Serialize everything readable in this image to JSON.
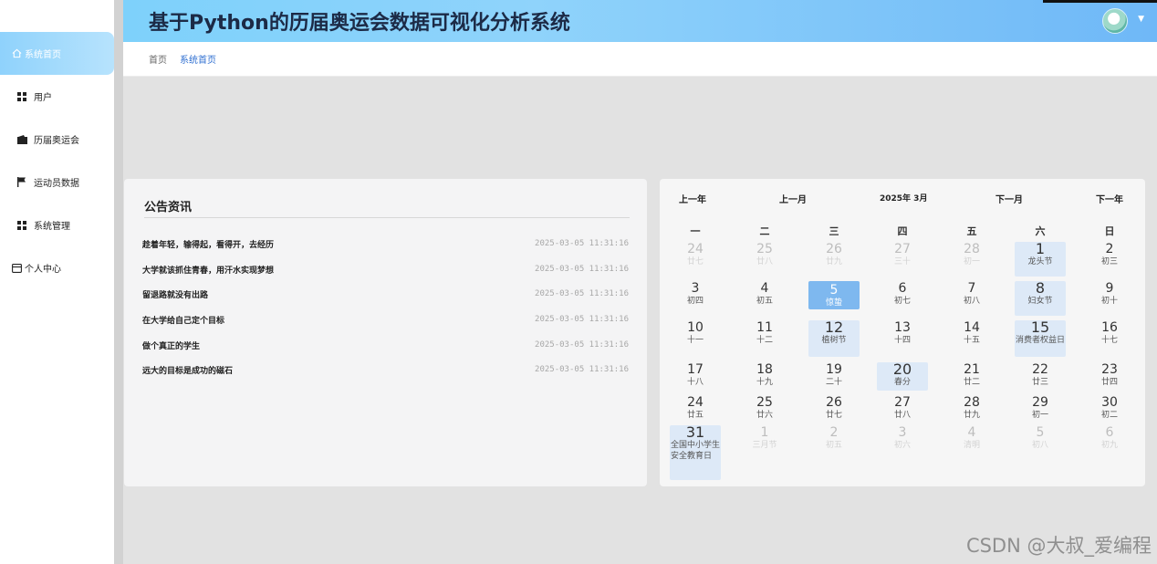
{
  "header": {
    "title": "基于Python的历届奥运会数据可视化分析系统"
  },
  "sidebar": {
    "items": [
      {
        "label": "系统首页",
        "icon": "home-icon"
      },
      {
        "label": "用户",
        "icon": "grid-icon"
      },
      {
        "label": "历届奥运会",
        "icon": "wallet-icon"
      },
      {
        "label": "运动员数据",
        "icon": "flag-icon"
      },
      {
        "label": "系统管理",
        "icon": "grid-icon"
      },
      {
        "label": "个人中心",
        "icon": "card-icon"
      }
    ]
  },
  "breadcrumb": {
    "home": "首页",
    "current": "系统首页"
  },
  "notices": {
    "title": "公告资讯",
    "items": [
      {
        "title": "趁着年轻，输得起，看得开，去经历",
        "date": "2025-03-05 11:31:16"
      },
      {
        "title": "大学就该抓住青春，用汗水实现梦想",
        "date": "2025-03-05 11:31:16"
      },
      {
        "title": "留退路就没有出路",
        "date": "2025-03-05 11:31:16"
      },
      {
        "title": "在大学给自己定个目标",
        "date": "2025-03-05 11:31:16"
      },
      {
        "title": "做个真正的学生",
        "date": "2025-03-05 11:31:16"
      },
      {
        "title": "远大的目标是成功的磁石",
        "date": "2025-03-05 11:31:16"
      }
    ]
  },
  "calendar": {
    "prev_year": "上一年",
    "prev_month": "上一月",
    "month_label": "2025年 3月",
    "next_month": "下一月",
    "next_year": "下一年",
    "weekdays": [
      "一",
      "二",
      "三",
      "四",
      "五",
      "六",
      "日"
    ],
    "days": [
      {
        "n": "24",
        "l": "廿七",
        "dim": true
      },
      {
        "n": "25",
        "l": "廿八",
        "dim": true
      },
      {
        "n": "26",
        "l": "廿九",
        "dim": true
      },
      {
        "n": "27",
        "l": "三十",
        "dim": true
      },
      {
        "n": "28",
        "l": "初一",
        "dim": true
      },
      {
        "n": "1",
        "l": "龙头节",
        "hl": true
      },
      {
        "n": "2",
        "l": "初三"
      },
      {
        "n": "3",
        "l": "初四"
      },
      {
        "n": "4",
        "l": "初五"
      },
      {
        "n": "5",
        "l": "惊蛰",
        "sel": true
      },
      {
        "n": "6",
        "l": "初七"
      },
      {
        "n": "7",
        "l": "初八"
      },
      {
        "n": "8",
        "l": "妇女节",
        "hl": true
      },
      {
        "n": "9",
        "l": "初十"
      },
      {
        "n": "10",
        "l": "十一"
      },
      {
        "n": "11",
        "l": "十二"
      },
      {
        "n": "12",
        "l": "植树节",
        "hl": true
      },
      {
        "n": "13",
        "l": "十四"
      },
      {
        "n": "14",
        "l": "十五"
      },
      {
        "n": "15",
        "l": "消费者权益日",
        "hl": true
      },
      {
        "n": "16",
        "l": "十七"
      },
      {
        "n": "17",
        "l": "十八"
      },
      {
        "n": "18",
        "l": "十九"
      },
      {
        "n": "19",
        "l": "二十"
      },
      {
        "n": "20",
        "l": "春分",
        "hl": true
      },
      {
        "n": "21",
        "l": "廿二"
      },
      {
        "n": "22",
        "l": "廿三"
      },
      {
        "n": "23",
        "l": "廿四"
      },
      {
        "n": "24",
        "l": "廿五"
      },
      {
        "n": "25",
        "l": "廿六"
      },
      {
        "n": "26",
        "l": "廿七"
      },
      {
        "n": "27",
        "l": "廿八"
      },
      {
        "n": "28",
        "l": "廿九"
      },
      {
        "n": "29",
        "l": "初一"
      },
      {
        "n": "30",
        "l": "初二"
      },
      {
        "n": "31",
        "l": "全国中小学生安全教育日",
        "hl": true
      },
      {
        "n": "1",
        "l": "三月节",
        "dim": true
      },
      {
        "n": "2",
        "l": "初五",
        "dim": true
      },
      {
        "n": "3",
        "l": "初六",
        "dim": true
      },
      {
        "n": "4",
        "l": "清明",
        "dim": true
      },
      {
        "n": "5",
        "l": "初八",
        "dim": true
      },
      {
        "n": "6",
        "l": "初九",
        "dim": true
      }
    ]
  },
  "watermark": "CSDN @大叔_爱编程"
}
